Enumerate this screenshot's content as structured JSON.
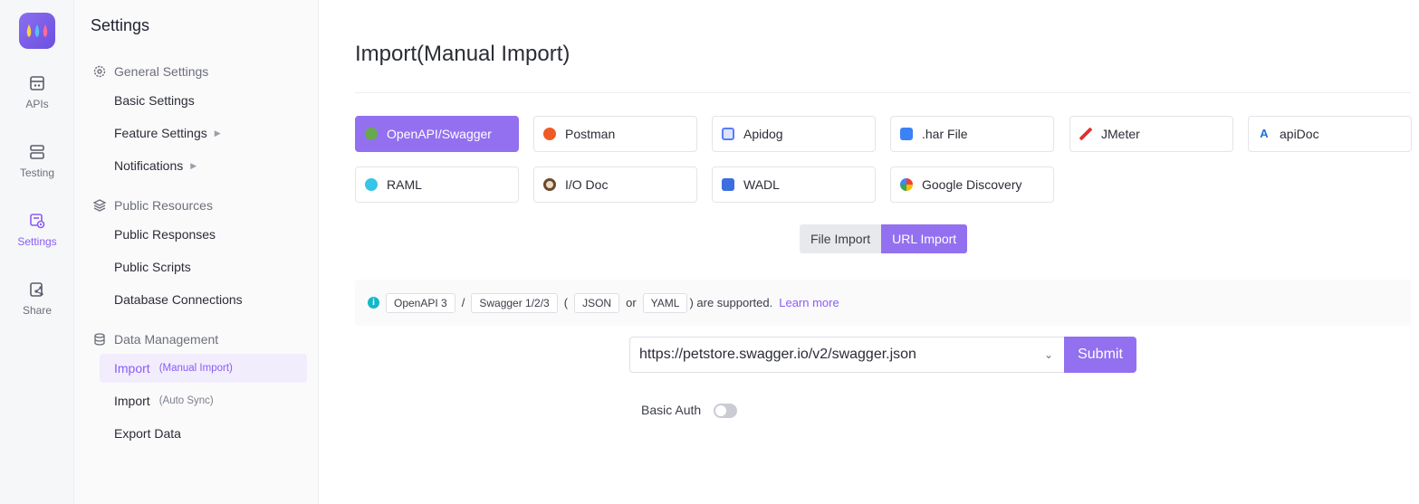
{
  "rail": {
    "items": [
      {
        "label": "APIs",
        "icon": "api-icon"
      },
      {
        "label": "Testing",
        "icon": "testing-icon"
      },
      {
        "label": "Settings",
        "icon": "settings-icon"
      },
      {
        "label": "Share",
        "icon": "share-icon"
      }
    ],
    "active": "Settings"
  },
  "sidebar": {
    "title": "Settings",
    "groups": {
      "general": "General Settings",
      "public": "Public Resources",
      "data": "Data Management"
    },
    "items": {
      "basic": "Basic Settings",
      "feature": "Feature Settings",
      "notifications": "Notifications",
      "responses": "Public Responses",
      "scripts": "Public Scripts",
      "db": "Database Connections",
      "import_manual": "Import",
      "import_manual_sub": "(Manual Import)",
      "import_auto": "Import",
      "import_auto_sub": "(Auto Sync)",
      "export": "Export Data"
    }
  },
  "main": {
    "title": "Import(Manual Import)",
    "formats": [
      {
        "label": "OpenAPI/Swagger",
        "color": "#6aa84f"
      },
      {
        "label": "Postman",
        "color": "#ef5b25"
      },
      {
        "label": "Apidog",
        "color": "#5b7cf5"
      },
      {
        "label": ".har File",
        "color": "#3b82f6"
      },
      {
        "label": "JMeter",
        "color": "#d33"
      },
      {
        "label": "apiDoc",
        "color": "#1e6fd9"
      },
      {
        "label": "RAML",
        "color": "#35c5e8"
      },
      {
        "label": "I/O Doc",
        "color": "#6b4a2a"
      },
      {
        "label": "WADL",
        "color": "#3b6fe0"
      },
      {
        "label": "Google Discovery",
        "color": "#e8a33b"
      }
    ],
    "import_tabs": {
      "file": "File Import",
      "url": "URL Import"
    },
    "info": {
      "tag_openapi": "OpenAPI 3",
      "slash": "/",
      "tag_swagger": "Swagger 1/2/3",
      "paren_open": "(",
      "tag_json": "JSON",
      "or": "or",
      "tag_yaml": "YAML",
      "supported": ") are supported.",
      "learn_more": "Learn more"
    },
    "url_value": "https://petstore.swagger.io/v2/swagger.json",
    "submit": "Submit",
    "basic_auth": "Basic Auth",
    "accent": "#9370f0"
  }
}
